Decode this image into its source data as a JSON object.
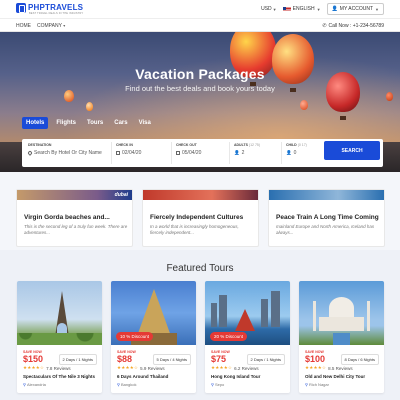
{
  "header": {
    "logo_text": "PHPTRAVELS",
    "logo_tagline": "BEST TRAVEL DEALS IN THE INDUSTRY",
    "currency": "USD",
    "language": "ENGLISH",
    "account_label": "MY ACCOUNT",
    "flag_icon": "us-flag-icon",
    "user_icon": "user-icon"
  },
  "nav": {
    "links": [
      "HOME",
      "COMPANY"
    ],
    "phone": "Call Now : +1-234-56789"
  },
  "hero": {
    "title": "Vacation Packages",
    "subtitle": "Find out the best deals and book yours today"
  },
  "search": {
    "tabs": [
      "Hotels",
      "Flights",
      "Tours",
      "Cars",
      "Visa"
    ],
    "active_tab": "Hotels",
    "destination": {
      "label": "DESTINATION",
      "placeholder": "Search By Hotel Or City Name"
    },
    "check_in": {
      "label": "CHECK IN",
      "value": "02/04/20"
    },
    "check_out": {
      "label": "CHECK OUT",
      "value": "05/04/20"
    },
    "adults": {
      "label": "ADULTS",
      "note": "(12 75)",
      "value": "2"
    },
    "child": {
      "label": "CHILD",
      "note": "(0 17)",
      "value": "0"
    },
    "button_label": "SEARCH",
    "accent_color": "#1a4bd8"
  },
  "offers": [
    {
      "brand": "dubai",
      "title": "Virgin Gorda beaches and...",
      "description": "This is the second leg of a truly fun week. There are adventures..."
    },
    {
      "brand": "",
      "title": "Fiercely Independent Cultures",
      "description": "In a world that is increasingly homogeneous, fiercely independent..."
    },
    {
      "brand": "",
      "title": "Peace Train A Long Time Coming",
      "description": "mainland Europe and North America, Iceland has always..."
    }
  ],
  "featured": {
    "title": "Featured Tours",
    "tours": [
      {
        "save": "SAVE NOW",
        "price": "$150",
        "duration": "2 Days / 1 Nights",
        "stars": "★★★★☆",
        "reviews": "7.8 Reviews",
        "name": "Spectaculars Of The Nile 3 Nights",
        "location": "Alexandria",
        "discount": ""
      },
      {
        "save": "SAVE NOW",
        "price": "$88",
        "duration": "5 Days / 4 Nights",
        "stars": "★★★★☆",
        "reviews": "5.9 Reviews",
        "name": "6 Days Around Thailand",
        "location": "Bangkok",
        "discount": "10 % Discount"
      },
      {
        "save": "SAVE NOW",
        "price": "$75",
        "duration": "2 Days / 1 Nights",
        "stars": "★★★★☆",
        "reviews": "6.2 Reviews",
        "name": "Hong Kong Island Tour",
        "location": "Sepo",
        "discount": "20 % Discount"
      },
      {
        "save": "SAVE NOW",
        "price": "$100",
        "duration": "8 Days / 6 Nights",
        "stars": "★★★★☆",
        "reviews": "8.5 Reviews",
        "name": "Old and New Delhi City Tour",
        "location": "Rich Nagar",
        "discount": ""
      }
    ]
  }
}
